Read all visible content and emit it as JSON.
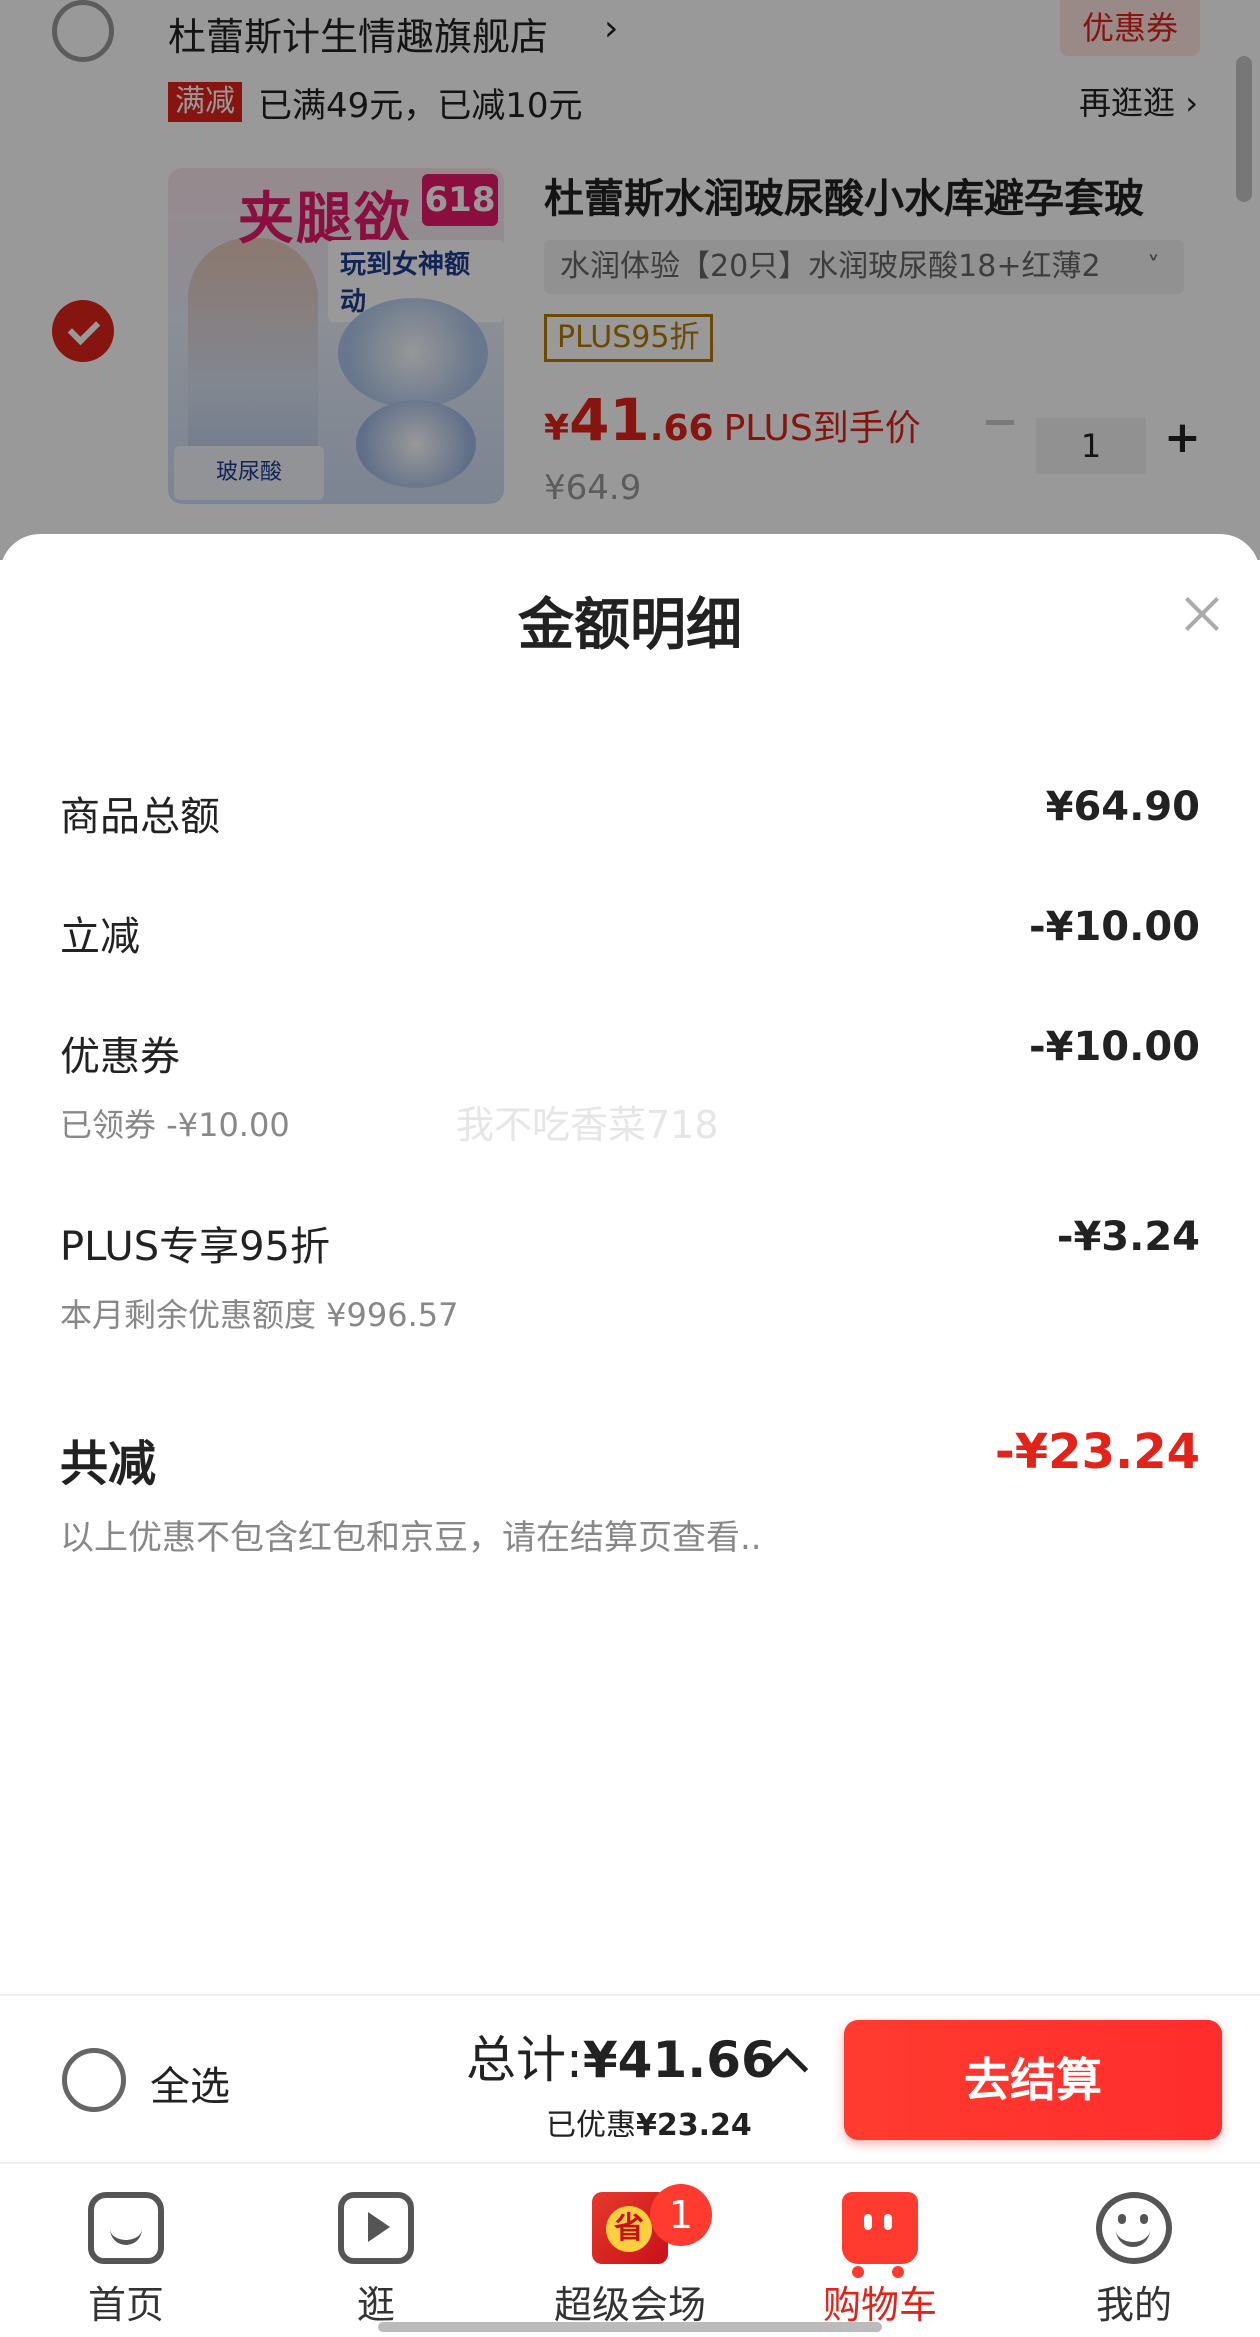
{
  "cart": {
    "store_name": "杜蕾斯计生情趣旗舰店",
    "store_arrow": "›",
    "coupon_tag": "优惠券",
    "promo_badge": "满减",
    "promo_text": "已满49元，已减10元",
    "revisit": "再逛逛 ›",
    "product": {
      "thumb_title": "夹腿欲",
      "thumb_618": "618",
      "thumb_sub": "玩到女神额动",
      "thumb_box": "玻尿酸",
      "title": "杜蕾斯水润玻尿酸小水库避孕套玻",
      "variant": "水润体验【20只】水润玻尿酸18+红薄2",
      "variant_chevron": "˅",
      "plus_tag": "PLUS95折",
      "price_currency": "¥",
      "price_int": "41",
      "price_dec": ".66",
      "price_label": "PLUS到手价",
      "price_old": "¥64.9",
      "quantity": "1",
      "plus_symbol": "+"
    }
  },
  "sheet": {
    "title": "金额明细",
    "rows": [
      {
        "label": "商品总额",
        "value": "¥64.90"
      },
      {
        "label": "立减",
        "value": "-¥10.00"
      },
      {
        "label": "优惠券",
        "value": "-¥10.00",
        "sub": "已领券 -¥10.00"
      },
      {
        "label": "PLUS专享95折",
        "value": "-¥3.24",
        "sub": "本月剩余优惠额度 ¥996.57"
      }
    ],
    "watermark": "我不吃香菜718",
    "total_label": "共减",
    "total_value": "-¥23.24",
    "note": "以上优惠不包含红包和京豆，请在结算页查看.."
  },
  "action_bar": {
    "select_all": "全选",
    "total_prefix": "总计:",
    "total_value": "¥41.66",
    "saved_prefix": "已优惠",
    "saved_value": "¥23.24",
    "checkout": "去结算"
  },
  "tabs": [
    {
      "label": "首页",
      "icon": "home-icon"
    },
    {
      "label": "逛",
      "icon": "video-icon"
    },
    {
      "label": "超级会场",
      "icon": "venue-icon",
      "badge": "1",
      "icon_char": "省"
    },
    {
      "label": "购物车",
      "icon": "cart-icon",
      "active": true
    },
    {
      "label": "我的",
      "icon": "profile-icon"
    }
  ],
  "colors": {
    "accent": "#e2231a",
    "plus": "#b47a00"
  }
}
